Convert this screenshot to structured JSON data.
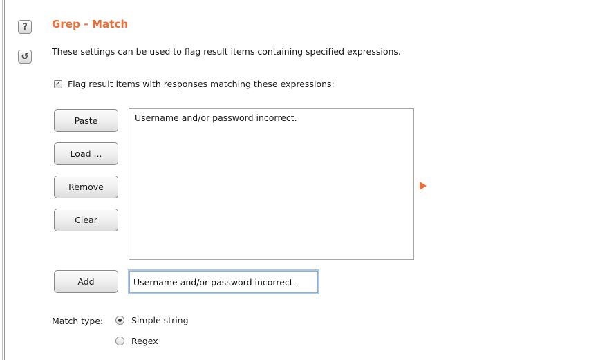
{
  "header": {
    "title": "Grep - Match",
    "description": "These settings can be used to flag result items containing specified expressions.",
    "help_icon": "?",
    "refresh_icon": "↺"
  },
  "flag_option": {
    "checked": true,
    "check_mark": "✓",
    "label": "Flag result items with responses matching these expressions:"
  },
  "buttons": {
    "paste": "Paste",
    "load": "Load ...",
    "remove": "Remove",
    "clear": "Clear",
    "add": "Add"
  },
  "expressions": [
    "Username and/or password incorrect."
  ],
  "new_expression": {
    "value": "Username and/or password incorrect."
  },
  "match_type": {
    "label": "Match type:",
    "options": [
      {
        "label": "Simple string",
        "selected": true
      },
      {
        "label": "Regex",
        "selected": false
      }
    ]
  },
  "colors": {
    "accent": "#ef6c35"
  }
}
